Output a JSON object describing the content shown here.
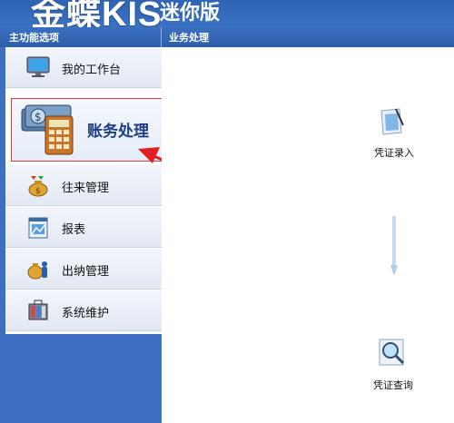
{
  "app": {
    "brand": "金蝶KIS",
    "edition": "迷你版"
  },
  "sidebar": {
    "title": "主功能选项",
    "items": [
      {
        "label": "我的工作台",
        "icon": "monitor-icon"
      },
      {
        "label": "账务处理",
        "icon": "calculator-money-icon",
        "selected": true
      },
      {
        "label": "往来管理",
        "icon": "money-bag-exchange-icon"
      },
      {
        "label": "报表",
        "icon": "report-icon"
      },
      {
        "label": "出纳管理",
        "icon": "cashier-bag-icon"
      },
      {
        "label": "系统维护",
        "icon": "toolbox-icon"
      }
    ]
  },
  "main": {
    "title": "业务处理",
    "flow": [
      {
        "label": "凭证录入",
        "icon": "voucher-entry-icon"
      },
      {
        "label": "凭证查询",
        "icon": "voucher-query-icon"
      }
    ]
  },
  "colors": {
    "header_blue": "#2e5ea9",
    "sidebar_blue": "#3c6fbf",
    "highlight_red": "#e23a3a",
    "selected_label": "#1d3d86"
  }
}
